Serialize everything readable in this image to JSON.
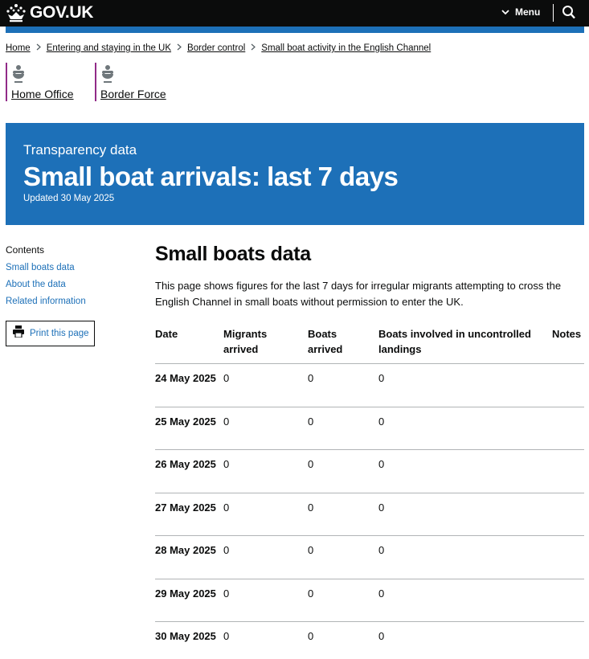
{
  "header": {
    "logo_text": "GOV.UK",
    "menu_label": "Menu",
    "search_icon": "search-icon",
    "chevron_icon": "chevron-down-icon",
    "crown_icon": "crown-icon"
  },
  "breadcrumbs": [
    "Home",
    "Entering and staying in the UK",
    "Border control",
    "Small boat activity in the English Channel"
  ],
  "organisations": [
    {
      "name": "Home Office",
      "icon": "royal-crest-icon"
    },
    {
      "name": "Border Force",
      "icon": "royal-crest-icon"
    }
  ],
  "banner": {
    "document_type": "Transparency data",
    "title": "Small boat arrivals: last 7 days",
    "updated": "Updated 30 May 2025"
  },
  "sidebar": {
    "contents_heading": "Contents",
    "links": [
      "Small boats data",
      "About the data",
      "Related information"
    ],
    "print_label": "Print this page",
    "print_icon": "printer-icon"
  },
  "main": {
    "section_title": "Small boats data",
    "intro": "This page shows figures for the last 7 days for irregular migrants attempting to cross the English Channel in small boats without permission to enter the UK.",
    "table": {
      "headers": [
        "Date",
        "Migrants arrived",
        "Boats arrived",
        "Boats involved in uncontrolled landings",
        "Notes"
      ],
      "rows": [
        {
          "date": "24 May 2025",
          "migrants": "0",
          "boats": "0",
          "uncontrolled": "0",
          "notes": ""
        },
        {
          "date": "25 May 2025",
          "migrants": "0",
          "boats": "0",
          "uncontrolled": "0",
          "notes": ""
        },
        {
          "date": "26 May 2025",
          "migrants": "0",
          "boats": "0",
          "uncontrolled": "0",
          "notes": ""
        },
        {
          "date": "27 May 2025",
          "migrants": "0",
          "boats": "0",
          "uncontrolled": "0",
          "notes": ""
        },
        {
          "date": "28 May 2025",
          "migrants": "0",
          "boats": "0",
          "uncontrolled": "0",
          "notes": ""
        },
        {
          "date": "29 May 2025",
          "migrants": "0",
          "boats": "0",
          "uncontrolled": "0",
          "notes": ""
        },
        {
          "date": "30 May 2025",
          "migrants": "0",
          "boats": "0",
          "uncontrolled": "0",
          "notes": ""
        }
      ]
    }
  },
  "colors": {
    "header_bg": "#0b0c0c",
    "brand_blue": "#1d70b8",
    "org_brand": "#912b88",
    "border": "#b1b4b6"
  }
}
